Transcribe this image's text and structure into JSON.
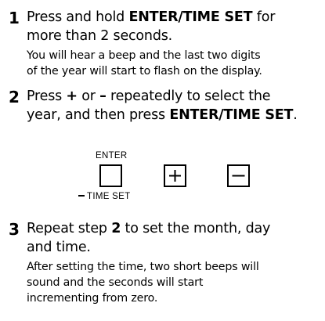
{
  "steps": [
    {
      "number": "1",
      "lines": [
        {
          "pre": "Press and hold ",
          "bold": "ENTER/TIME SET",
          "post": " for"
        },
        {
          "text": "more than 2 seconds."
        }
      ],
      "note": [
        "You will hear a beep and the last two digits",
        "of the year will start to flash on the display."
      ]
    },
    {
      "number": "2",
      "lines": [
        {
          "pre": "Press ",
          "bold": "+",
          "mid": " or ",
          "bold2": "–",
          "post": " repeatedly to select the"
        },
        {
          "pre": "year, and then press ",
          "bold": "ENTER/TIME SET",
          "post": "."
        }
      ]
    },
    {
      "number": "3",
      "lines": [
        {
          "pre": "Repeat step ",
          "bold": "2",
          "post": " to set the month, day"
        },
        {
          "text": "and time."
        }
      ],
      "note": [
        "After setting the time, two short beeps will",
        "sound and the seconds will start",
        "incrementing from zero."
      ]
    }
  ],
  "diagram": {
    "enter_label": "ENTER",
    "timeset_label": "TIME SET",
    "buttons": [
      "enter-button",
      "plus-button",
      "minus-button"
    ]
  }
}
